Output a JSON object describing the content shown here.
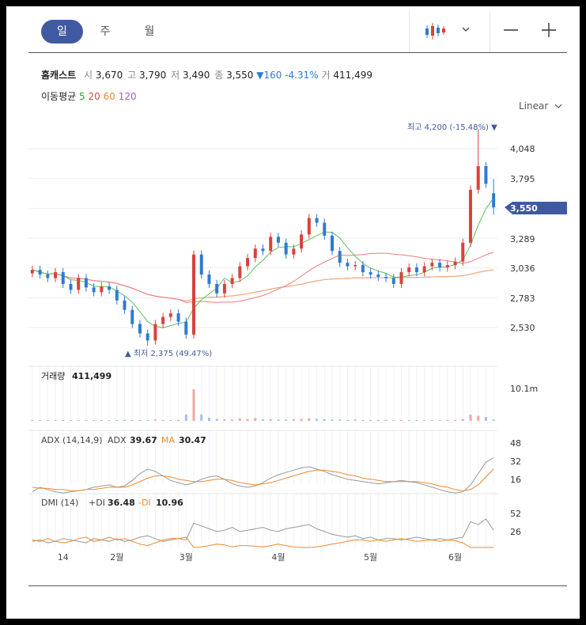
{
  "periods": [
    {
      "label": "일",
      "active": true
    },
    {
      "label": "주",
      "active": false
    },
    {
      "label": "월",
      "active": false
    }
  ],
  "stock": {
    "name": "홈캐스트",
    "open_label": "시",
    "open": "3,670",
    "high_label": "고",
    "high": "3,790",
    "low_label": "저",
    "low": "3,490",
    "close_label": "종",
    "close": "3,550",
    "change": "▼160",
    "change_pct": "-4.31%",
    "vol_label": "거",
    "volume": "411,499"
  },
  "ma": {
    "label": "이동평균",
    "items": [
      {
        "n": "5",
        "color": "#2aa62a"
      },
      {
        "n": "20",
        "color": "#e0413e"
      },
      {
        "n": "60",
        "color": "#f08a2c"
      },
      {
        "n": "120",
        "color": "#9b5fd6"
      }
    ]
  },
  "scale_label": "Linear",
  "icons": {
    "chart_type": "candlestick-icon",
    "dropdown": "chevron-down-icon",
    "zoom_out": "minus-icon",
    "zoom_in": "plus-icon"
  },
  "colors": {
    "up": "#d9423c",
    "down": "#2d7bd1",
    "accent": "#3f5aa0"
  },
  "price_axis": [
    "4,048",
    "3,795",
    "3,542",
    "3,289",
    "3,036",
    "2,783",
    "2,530"
  ],
  "current_price": "3,550",
  "high_annot": "최고 4,200 (-15.48%) ▼",
  "low_annot": "▲ 최저 2,375 (49.47%)",
  "volume_panel": {
    "title": "거래량",
    "value": "411,499",
    "axis": "10.1m"
  },
  "adx_panel": {
    "title": "ADX (14,14,9)",
    "adx_label": "ADX",
    "adx_value": "39.67",
    "ma_label": "MA",
    "ma_value": "30.47",
    "axis": [
      "48",
      "32",
      "16"
    ]
  },
  "dmi_panel": {
    "title": "DMI (14)",
    "pdi_label": "+DI",
    "pdi_value": "36.48",
    "mdi_label": "-DI",
    "mdi_value": "10.96",
    "axis": [
      "52",
      "26"
    ]
  },
  "x_axis": [
    "14",
    "2월",
    "3월",
    "4월",
    "5월",
    "6월"
  ],
  "chart_data": {
    "type": "candlestick",
    "ylim": [
      2375,
      4200
    ],
    "ticks": [
      4048,
      3795,
      3542,
      3289,
      3036,
      2783,
      2530
    ],
    "x_ticks": [
      {
        "label": "14",
        "i": 4
      },
      {
        "label": "2월",
        "i": 11
      },
      {
        "label": "3월",
        "i": 20
      },
      {
        "label": "4월",
        "i": 32
      },
      {
        "label": "5월",
        "i": 44
      },
      {
        "label": "6월",
        "i": 55
      }
    ],
    "high": {
      "value": 4200,
      "pct": "-15.48%"
    },
    "low": {
      "value": 2375,
      "pct": "49.47%"
    },
    "last": {
      "open": 3670,
      "high": 3790,
      "low": 3490,
      "close": 3550,
      "volume": 411499
    },
    "close": [
      3020,
      2980,
      2950,
      3000,
      2900,
      2850,
      2950,
      2870,
      2830,
      2880,
      2850,
      2760,
      2680,
      2560,
      2480,
      2420,
      2560,
      2620,
      2650,
      2580,
      2470,
      3150,
      2980,
      2900,
      2820,
      2900,
      2950,
      3050,
      3120,
      3200,
      3180,
      3300,
      3250,
      3150,
      3200,
      3320,
      3460,
      3420,
      3310,
      3180,
      3080,
      3050,
      3060,
      3000,
      2980,
      2960,
      2950,
      2900,
      3000,
      3040,
      3000,
      3050,
      3080,
      3040,
      3060,
      3090,
      3250,
      3700,
      3900,
      3750,
      3550
    ],
    "volume_rel": [
      0.03,
      0.02,
      0.02,
      0.03,
      0.02,
      0.02,
      0.02,
      0.02,
      0.02,
      0.02,
      0.02,
      0.02,
      0.03,
      0.03,
      0.03,
      0.02,
      0.04,
      0.03,
      0.02,
      0.03,
      0.2,
      1.0,
      0.2,
      0.1,
      0.06,
      0.05,
      0.04,
      0.08,
      0.06,
      0.09,
      0.05,
      0.05,
      0.04,
      0.04,
      0.05,
      0.06,
      0.08,
      0.06,
      0.05,
      0.04,
      0.04,
      0.03,
      0.04,
      0.03,
      0.03,
      0.03,
      0.03,
      0.02,
      0.03,
      0.03,
      0.03,
      0.02,
      0.02,
      0.02,
      0.03,
      0.03,
      0.06,
      0.2,
      0.16,
      0.12,
      0.04
    ],
    "adx": [
      10,
      14,
      12,
      10,
      9,
      10,
      11,
      12,
      14,
      15,
      16,
      14,
      15,
      20,
      26,
      30,
      28,
      24,
      20,
      18,
      16,
      18,
      21,
      23,
      24,
      21,
      17,
      15,
      14,
      15,
      18,
      22,
      25,
      27,
      29,
      31,
      32,
      30,
      28,
      25,
      23,
      21,
      20,
      19,
      18,
      17,
      18,
      19,
      20,
      19,
      18,
      16,
      14,
      12,
      10,
      9,
      10,
      16,
      26,
      36,
      40
    ],
    "adx_ma": [
      14,
      13,
      13,
      12,
      12,
      11,
      11,
      12,
      12,
      13,
      14,
      14,
      14,
      16,
      19,
      22,
      24,
      24,
      23,
      21,
      20,
      19,
      19,
      20,
      21,
      21,
      20,
      18,
      17,
      16,
      17,
      18,
      20,
      22,
      24,
      26,
      28,
      29,
      29,
      28,
      27,
      25,
      24,
      22,
      21,
      20,
      19,
      19,
      19,
      19,
      19,
      18,
      17,
      15,
      14,
      12,
      11,
      12,
      16,
      23,
      30
    ],
    "pdi": [
      20,
      22,
      18,
      20,
      24,
      22,
      20,
      18,
      24,
      22,
      20,
      24,
      20,
      22,
      26,
      28,
      24,
      20,
      22,
      24,
      22,
      46,
      42,
      38,
      34,
      36,
      40,
      34,
      36,
      38,
      40,
      36,
      34,
      38,
      40,
      42,
      44,
      38,
      34,
      30,
      28,
      26,
      28,
      24,
      26,
      22,
      24,
      24,
      22,
      24,
      26,
      24,
      22,
      24,
      22,
      24,
      26,
      48,
      44,
      52,
      36
    ],
    "mdi": [
      22,
      20,
      24,
      20,
      18,
      20,
      24,
      26,
      20,
      22,
      26,
      22,
      24,
      20,
      16,
      14,
      18,
      22,
      24,
      24,
      26,
      10,
      12,
      14,
      16,
      15,
      12,
      14,
      14,
      13,
      12,
      14,
      16,
      14,
      12,
      11,
      10,
      12,
      14,
      16,
      18,
      20,
      22,
      22,
      20,
      22,
      20,
      22,
      24,
      22,
      20,
      21,
      22,
      20,
      22,
      21,
      18,
      10,
      8,
      6,
      11
    ]
  }
}
